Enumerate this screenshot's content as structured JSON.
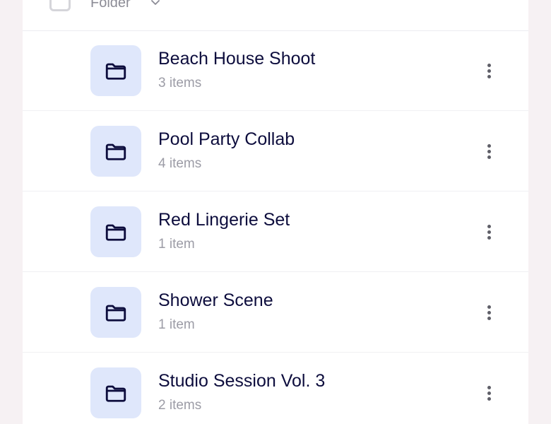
{
  "header": {
    "sort_label": "Folder",
    "sort_icon": "chevron-down-icon",
    "checkbox_icon": "checkbox-unchecked"
  },
  "folders": [
    {
      "name": "Beach House Shoot",
      "count": "3 items",
      "icon": "folder-icon"
    },
    {
      "name": "Pool Party Collab",
      "count": "4 items",
      "icon": "folder-icon"
    },
    {
      "name": "Red Lingerie Set",
      "count": "1 item",
      "icon": "folder-icon"
    },
    {
      "name": "Shower Scene",
      "count": "1 item",
      "icon": "folder-icon"
    },
    {
      "name": "Studio Session Vol. 3",
      "count": "2 items",
      "icon": "folder-icon"
    }
  ],
  "colors": {
    "background": "#f6f1f3",
    "panel": "#ffffff",
    "folder_tile": "#dfe7fb",
    "folder_icon_stroke": "#0d0d3d",
    "title_text": "#0d0d3d",
    "meta_text": "#9c9ca6"
  }
}
